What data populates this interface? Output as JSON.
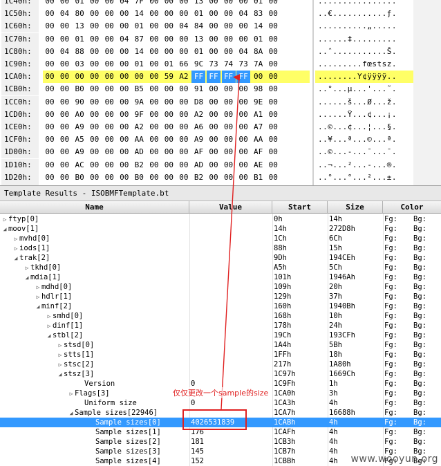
{
  "hex": {
    "rows": [
      {
        "addr": "1C40h:",
        "bytes": [
          "00",
          "00",
          "01",
          "00",
          "00",
          "04",
          "7F",
          "00",
          "00",
          "00",
          "13",
          "00",
          "00",
          "00",
          "01",
          "00"
        ],
        "ascii": "................"
      },
      {
        "addr": "1C50h:",
        "bytes": [
          "00",
          "04",
          "80",
          "00",
          "00",
          "00",
          "14",
          "00",
          "00",
          "00",
          "01",
          "00",
          "00",
          "04",
          "83",
          "00"
        ],
        "ascii": "..€...........ƒ."
      },
      {
        "addr": "1C60h:",
        "bytes": [
          "00",
          "00",
          "13",
          "00",
          "00",
          "00",
          "01",
          "00",
          "00",
          "04",
          "84",
          "00",
          "00",
          "00",
          "14",
          "00"
        ],
        "ascii": "..........„....."
      },
      {
        "addr": "1C70h:",
        "bytes": [
          "00",
          "00",
          "01",
          "00",
          "00",
          "04",
          "87",
          "00",
          "00",
          "00",
          "13",
          "00",
          "00",
          "00",
          "01",
          "00"
        ],
        "ascii": "......‡........."
      },
      {
        "addr": "1C80h:",
        "bytes": [
          "00",
          "04",
          "88",
          "00",
          "00",
          "00",
          "14",
          "00",
          "00",
          "00",
          "01",
          "00",
          "00",
          "04",
          "8A",
          "00"
        ],
        "ascii": "..ˆ...........Š."
      },
      {
        "addr": "1C90h:",
        "bytes": [
          "00",
          "00",
          "03",
          "00",
          "00",
          "00",
          "01",
          "00",
          "01",
          "66",
          "9C",
          "73",
          "74",
          "73",
          "7A",
          "00"
        ],
        "ascii": ".........fœstsz."
      },
      {
        "addr": "1CA0h:",
        "bytes": [
          "00",
          "00",
          "00",
          "00",
          "00",
          "00",
          "00",
          "00",
          "59",
          "A2",
          "FF",
          "FF",
          "FF",
          "FF",
          "00",
          "00"
        ],
        "ascii": "........Y¢ÿÿÿÿ..",
        "highlight": true,
        "selected_from": 10,
        "selected_to": 13
      },
      {
        "addr": "1CB0h:",
        "bytes": [
          "00",
          "00",
          "B0",
          "00",
          "00",
          "00",
          "B5",
          "00",
          "00",
          "00",
          "91",
          "00",
          "00",
          "00",
          "98",
          "00"
        ],
        "ascii": "..°...µ...'...˜."
      },
      {
        "addr": "1CC0h:",
        "bytes": [
          "00",
          "00",
          "90",
          "00",
          "00",
          "00",
          "9A",
          "00",
          "00",
          "00",
          "D8",
          "00",
          "00",
          "00",
          "9E",
          "00"
        ],
        "ascii": "......š...Ø...ž."
      },
      {
        "addr": "1CD0h:",
        "bytes": [
          "00",
          "00",
          "A0",
          "00",
          "00",
          "00",
          "9F",
          "00",
          "00",
          "00",
          "A2",
          "00",
          "00",
          "00",
          "A1",
          "00"
        ],
        "ascii": "......Ÿ...¢...¡."
      },
      {
        "addr": "1CE0h:",
        "bytes": [
          "00",
          "00",
          "A9",
          "00",
          "00",
          "00",
          "A2",
          "00",
          "00",
          "00",
          "A6",
          "00",
          "00",
          "00",
          "A7",
          "00"
        ],
        "ascii": "..©...¢...¦...§."
      },
      {
        "addr": "1CF0h:",
        "bytes": [
          "00",
          "00",
          "A5",
          "00",
          "00",
          "00",
          "AA",
          "00",
          "00",
          "00",
          "A9",
          "00",
          "00",
          "00",
          "AA",
          "00"
        ],
        "ascii": "..¥...ª...©...ª."
      },
      {
        "addr": "1D00h:",
        "bytes": [
          "00",
          "00",
          "A9",
          "00",
          "00",
          "00",
          "AD",
          "00",
          "00",
          "00",
          "AF",
          "00",
          "00",
          "00",
          "AF",
          "00"
        ],
        "ascii": "..©...-...¯...¯."
      },
      {
        "addr": "1D10h:",
        "bytes": [
          "00",
          "00",
          "AC",
          "00",
          "00",
          "00",
          "B2",
          "00",
          "00",
          "00",
          "AD",
          "00",
          "00",
          "00",
          "AE",
          "00"
        ],
        "ascii": "..¬...²...-...®."
      },
      {
        "addr": "1D20h:",
        "bytes": [
          "00",
          "00",
          "B0",
          "00",
          "00",
          "00",
          "B0",
          "00",
          "00",
          "00",
          "B2",
          "00",
          "00",
          "00",
          "B1",
          "00"
        ],
        "ascii": "..°...°...²...±."
      },
      {
        "addr": "1D30h:",
        "bytes": [
          "00",
          "00",
          "B3",
          "00",
          "00",
          "00",
          "AD",
          "00",
          "00",
          "00",
          "B3",
          "00",
          "00",
          "00",
          "B3",
          "00"
        ],
        "ascii": "..³...-...³...³."
      }
    ]
  },
  "template": {
    "title": "Template Results - ISOBMFTemplate.bt",
    "columns": {
      "name": "Name",
      "value": "Value",
      "start": "Start",
      "size": "Size",
      "color": "Color"
    },
    "rows": [
      {
        "name": "ftyp[0]",
        "level": 0,
        "toggle": "closed",
        "value": "",
        "start": "0h",
        "size": "14h",
        "fg": "Fg:",
        "bg": "Bg:"
      },
      {
        "name": "moov[1]",
        "level": 0,
        "toggle": "open",
        "value": "",
        "start": "14h",
        "size": "272D8h",
        "fg": "Fg:",
        "bg": "Bg:"
      },
      {
        "name": "mvhd[0]",
        "level": 1,
        "toggle": "closed",
        "value": "",
        "start": "1Ch",
        "size": "6Ch",
        "fg": "Fg:",
        "bg": "Bg:"
      },
      {
        "name": "iods[1]",
        "level": 1,
        "toggle": "closed",
        "value": "",
        "start": "88h",
        "size": "15h",
        "fg": "Fg:",
        "bg": "Bg:"
      },
      {
        "name": "trak[2]",
        "level": 1,
        "toggle": "open",
        "value": "",
        "start": "9Dh",
        "size": "194CEh",
        "fg": "Fg:",
        "bg": "Bg:"
      },
      {
        "name": "tkhd[0]",
        "level": 2,
        "toggle": "closed",
        "value": "",
        "start": "A5h",
        "size": "5Ch",
        "fg": "Fg:",
        "bg": "Bg:"
      },
      {
        "name": "mdia[1]",
        "level": 2,
        "toggle": "open",
        "value": "",
        "start": "101h",
        "size": "1946Ah",
        "fg": "Fg:",
        "bg": "Bg:"
      },
      {
        "name": "mdhd[0]",
        "level": 3,
        "toggle": "closed",
        "value": "",
        "start": "109h",
        "size": "20h",
        "fg": "Fg:",
        "bg": "Bg:"
      },
      {
        "name": "hdlr[1]",
        "level": 3,
        "toggle": "closed",
        "value": "",
        "start": "129h",
        "size": "37h",
        "fg": "Fg:",
        "bg": "Bg:"
      },
      {
        "name": "minf[2]",
        "level": 3,
        "toggle": "open",
        "value": "",
        "start": "160h",
        "size": "1940Bh",
        "fg": "Fg:",
        "bg": "Bg:"
      },
      {
        "name": "smhd[0]",
        "level": 4,
        "toggle": "closed",
        "value": "",
        "start": "168h",
        "size": "10h",
        "fg": "Fg:",
        "bg": "Bg:"
      },
      {
        "name": "dinf[1]",
        "level": 4,
        "toggle": "closed",
        "value": "",
        "start": "178h",
        "size": "24h",
        "fg": "Fg:",
        "bg": "Bg:"
      },
      {
        "name": "stbl[2]",
        "level": 4,
        "toggle": "open",
        "value": "",
        "start": "19Ch",
        "size": "193CFh",
        "fg": "Fg:",
        "bg": "Bg:"
      },
      {
        "name": "stsd[0]",
        "level": 5,
        "toggle": "closed",
        "value": "",
        "start": "1A4h",
        "size": "5Bh",
        "fg": "Fg:",
        "bg": "Bg:"
      },
      {
        "name": "stts[1]",
        "level": 5,
        "toggle": "closed",
        "value": "",
        "start": "1FFh",
        "size": "18h",
        "fg": "Fg:",
        "bg": "Bg:"
      },
      {
        "name": "stsc[2]",
        "level": 5,
        "toggle": "closed",
        "value": "",
        "start": "217h",
        "size": "1A80h",
        "fg": "Fg:",
        "bg": "Bg:"
      },
      {
        "name": "stsz[3]",
        "level": 5,
        "toggle": "open",
        "value": "",
        "start": "1C97h",
        "size": "1669Ch",
        "fg": "Fg:",
        "bg": "Bg:"
      },
      {
        "name": "Version",
        "level": 6,
        "toggle": "none",
        "value": "0",
        "start": "1C9Fh",
        "size": "1h",
        "fg": "Fg:",
        "bg": "Bg:"
      },
      {
        "name": "Flags[3]",
        "level": 6,
        "toggle": "closed",
        "value": "",
        "start": "1CA0h",
        "size": "3h",
        "fg": "Fg:",
        "bg": "Bg:"
      },
      {
        "name": "Uniform size",
        "level": 6,
        "toggle": "none",
        "value": "0",
        "start": "1CA3h",
        "size": "4h",
        "fg": "Fg:",
        "bg": "Bg:"
      },
      {
        "name": "Sample sizes[22946]",
        "level": 6,
        "toggle": "open",
        "value": "",
        "start": "1CA7h",
        "size": "16688h",
        "fg": "Fg:",
        "bg": "Bg:"
      },
      {
        "name": "Sample sizes[0]",
        "level": 7,
        "toggle": "none",
        "value": "4026531839",
        "start": "1CABh",
        "size": "4h",
        "fg": "Fg:",
        "bg": "Bg:",
        "selected": true
      },
      {
        "name": "Sample sizes[1]",
        "level": 7,
        "toggle": "none",
        "value": "176",
        "start": "1CAFh",
        "size": "4h",
        "fg": "Fg:",
        "bg": "Bg:"
      },
      {
        "name": "Sample sizes[2]",
        "level": 7,
        "toggle": "none",
        "value": "181",
        "start": "1CB3h",
        "size": "4h",
        "fg": "Fg:",
        "bg": "Bg:"
      },
      {
        "name": "Sample sizes[3]",
        "level": 7,
        "toggle": "none",
        "value": "145",
        "start": "1CB7h",
        "size": "4h",
        "fg": "Fg:",
        "bg": "Bg:"
      },
      {
        "name": "Sample sizes[4]",
        "level": 7,
        "toggle": "none",
        "value": "152",
        "start": "1CBBh",
        "size": "4h",
        "fg": "Fg:",
        "bg": "Bg:"
      }
    ]
  },
  "annotation": {
    "label": "仅仅更改一个sample的size",
    "color": "#e02020"
  },
  "watermark": "www.wooyun.org",
  "colors": {
    "highlight_row": "#ffff66",
    "selection": "#3399ff"
  }
}
